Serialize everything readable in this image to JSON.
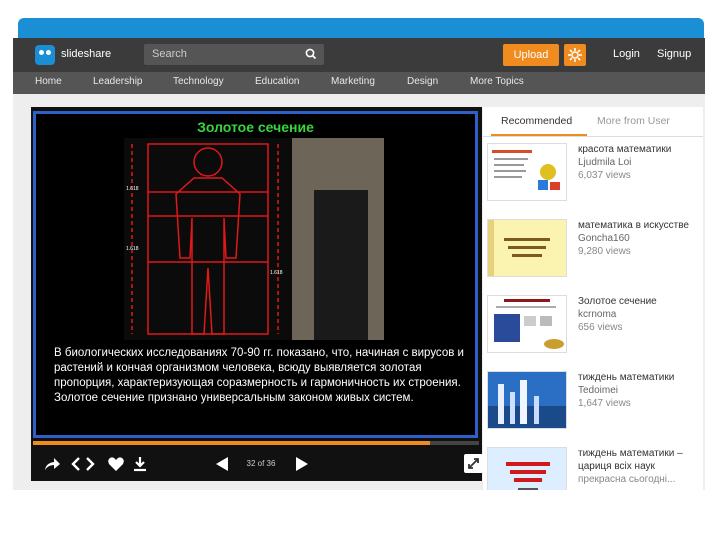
{
  "header": {
    "brand": "slideshare",
    "search_placeholder": "Search",
    "upload_label": "Upload",
    "login_label": "Login",
    "signup_label": "Signup"
  },
  "nav": {
    "items": [
      {
        "label": "Home"
      },
      {
        "label": "Leadership"
      },
      {
        "label": "Technology"
      },
      {
        "label": "Education"
      },
      {
        "label": "Marketing"
      },
      {
        "label": "Design"
      },
      {
        "label": "More Topics"
      }
    ]
  },
  "slide": {
    "title": "Золотое сечение",
    "text": "В биологических исследованиях 70-90 гг. показано, что, начиная с вирусов и растений и кончая организмом человека, всюду выявляется золотая пропорция, характеризующая соразмерность и гармоничность их строения. Золотое сечение признано универсальным законом живых систем.",
    "figure_labels": [
      "1.618",
      "1.618",
      "1.618"
    ]
  },
  "player": {
    "page_current": "32",
    "page_total": "36",
    "page_label": "32 of 36",
    "progress_fraction": 0.89
  },
  "sidebar": {
    "tab_recommended": "Recommended",
    "tab_more": "More from User",
    "items": [
      {
        "title": "красота математики",
        "author": "Ljudmila Loi",
        "views": "6,037 views"
      },
      {
        "title": "математика в искусстве",
        "author": "Goncha160",
        "views": "9,280 views"
      },
      {
        "title": "Золотое сечение",
        "author": "kcrnoma",
        "views": "656 views"
      },
      {
        "title": "тиждень математики",
        "author": "Tedoimei",
        "views": "1,647 views"
      },
      {
        "title": "тиждень математики – цариця всіх наук",
        "author": "",
        "views": "прекрасна сьогодні..."
      }
    ]
  },
  "colors": {
    "accent": "#f08c1f",
    "brand_blue": "#1a8fd6",
    "slide_title": "#39d43e",
    "figure_red": "#e01818"
  }
}
